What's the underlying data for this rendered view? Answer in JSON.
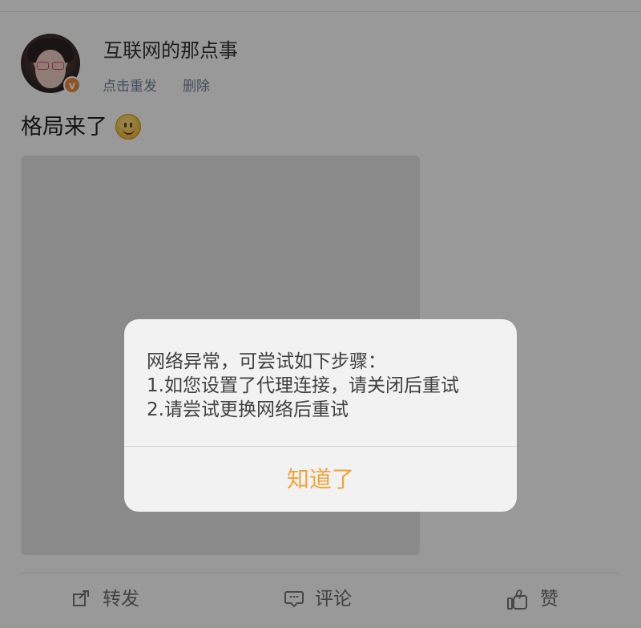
{
  "post": {
    "author_name": "互联网的那点事",
    "actions": {
      "retry": "点击重发",
      "delete": "删除"
    },
    "text": "格局来了",
    "emoji_icon": "smile-emoji"
  },
  "footer": {
    "repost_label": "转发",
    "comment_label": "评论",
    "like_label": "赞"
  },
  "dialog": {
    "line1": "网络异常，可尝试如下步骤：",
    "line2": "1.如您设置了代理连接，请关闭后重试",
    "line3": "2.请尝试更换网络后重试",
    "button_label": "知道了"
  },
  "colors": {
    "overlay": "rgba(0,0,0,0.40)",
    "dialog_background": "#f2f2f2",
    "dialog_button": "#f0a33b",
    "meta_link": "#6e7f9a",
    "verified_badge": "#ef8d3d"
  },
  "icons": {
    "avatar_badge": "verified-badge-icon",
    "repost": "repost-icon",
    "comment": "comment-icon",
    "like": "like-icon"
  }
}
